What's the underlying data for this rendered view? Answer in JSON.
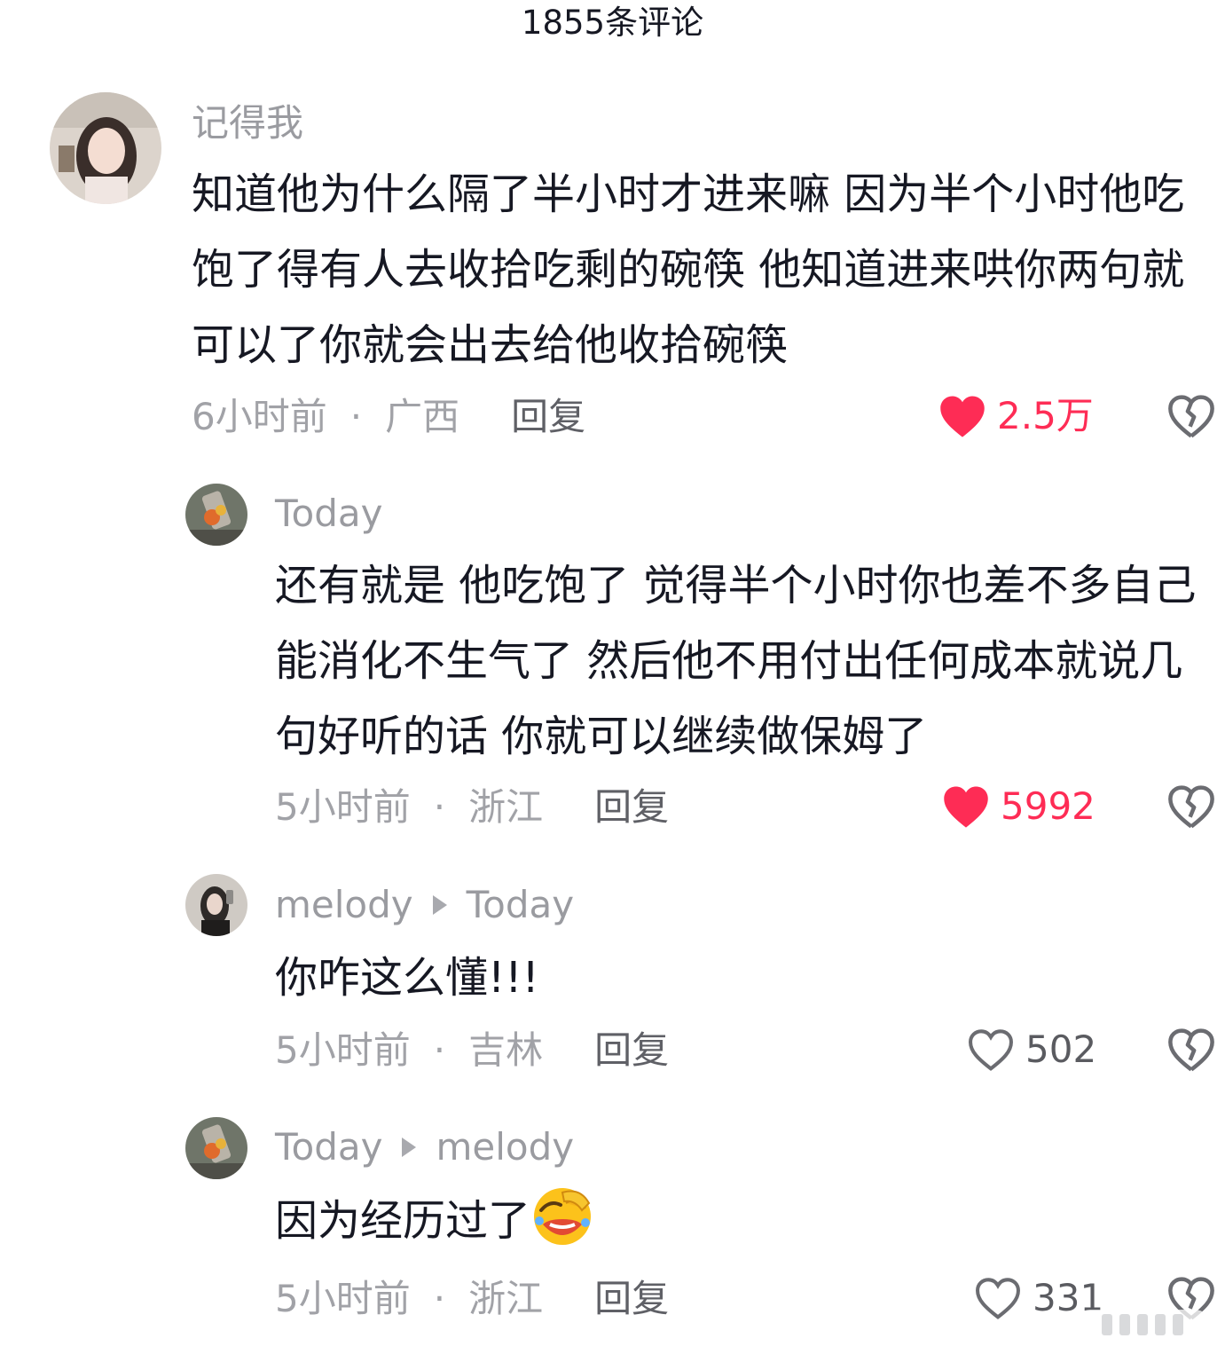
{
  "header": {
    "title": "1855条评论"
  },
  "comments": [
    {
      "user": "记得我",
      "text": "知道他为什么隔了半小时才进来嘛 因为半个小时他吃饱了得有人去收拾吃剩的碗筷 他知道进来哄你两句就可以了你就会出去给他收拾碗筷",
      "time": "6小时前",
      "location": "广西",
      "reply_label": "回复",
      "likes": "2.5万",
      "liked": true
    },
    {
      "user": "Today",
      "text": "还有就是 他吃饱了 觉得半个小时你也差不多自己能消化不生气了 然后他不用付出任何成本就说几句好听的话 你就可以继续做保姆了",
      "time": "5小时前",
      "location": "浙江",
      "reply_label": "回复",
      "likes": "5992",
      "liked": true
    },
    {
      "user": "melody",
      "reply_to": "Today",
      "text": "你咋这么懂!!!",
      "time": "5小时前",
      "location": "吉林",
      "reply_label": "回复",
      "likes": "502",
      "liked": false
    },
    {
      "user": "Today",
      "reply_to": "melody",
      "text": "因为经历过了",
      "emoji": "face-with-hand-over-mouth-laughing-emoji",
      "time": "5小时前",
      "location": "浙江",
      "reply_label": "回复",
      "likes": "331",
      "liked": false
    }
  ],
  "colors": {
    "like_active": "#fe2c55",
    "meta_gray": "#a1a2a7",
    "text": "#161823"
  },
  "icons": {
    "like": "heart-icon",
    "dislike": "broken-heart-icon"
  }
}
